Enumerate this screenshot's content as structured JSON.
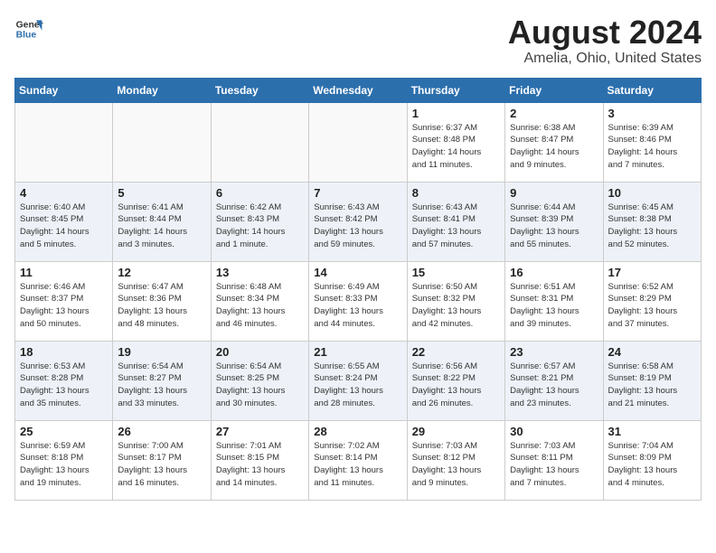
{
  "header": {
    "logo_line1": "General",
    "logo_line2": "Blue",
    "month_year": "August 2024",
    "location": "Amelia, Ohio, United States"
  },
  "weekdays": [
    "Sunday",
    "Monday",
    "Tuesday",
    "Wednesday",
    "Thursday",
    "Friday",
    "Saturday"
  ],
  "weeks": [
    [
      {
        "day": "",
        "info": ""
      },
      {
        "day": "",
        "info": ""
      },
      {
        "day": "",
        "info": ""
      },
      {
        "day": "",
        "info": ""
      },
      {
        "day": "1",
        "info": "Sunrise: 6:37 AM\nSunset: 8:48 PM\nDaylight: 14 hours\nand 11 minutes."
      },
      {
        "day": "2",
        "info": "Sunrise: 6:38 AM\nSunset: 8:47 PM\nDaylight: 14 hours\nand 9 minutes."
      },
      {
        "day": "3",
        "info": "Sunrise: 6:39 AM\nSunset: 8:46 PM\nDaylight: 14 hours\nand 7 minutes."
      }
    ],
    [
      {
        "day": "4",
        "info": "Sunrise: 6:40 AM\nSunset: 8:45 PM\nDaylight: 14 hours\nand 5 minutes."
      },
      {
        "day": "5",
        "info": "Sunrise: 6:41 AM\nSunset: 8:44 PM\nDaylight: 14 hours\nand 3 minutes."
      },
      {
        "day": "6",
        "info": "Sunrise: 6:42 AM\nSunset: 8:43 PM\nDaylight: 14 hours\nand 1 minute."
      },
      {
        "day": "7",
        "info": "Sunrise: 6:43 AM\nSunset: 8:42 PM\nDaylight: 13 hours\nand 59 minutes."
      },
      {
        "day": "8",
        "info": "Sunrise: 6:43 AM\nSunset: 8:41 PM\nDaylight: 13 hours\nand 57 minutes."
      },
      {
        "day": "9",
        "info": "Sunrise: 6:44 AM\nSunset: 8:39 PM\nDaylight: 13 hours\nand 55 minutes."
      },
      {
        "day": "10",
        "info": "Sunrise: 6:45 AM\nSunset: 8:38 PM\nDaylight: 13 hours\nand 52 minutes."
      }
    ],
    [
      {
        "day": "11",
        "info": "Sunrise: 6:46 AM\nSunset: 8:37 PM\nDaylight: 13 hours\nand 50 minutes."
      },
      {
        "day": "12",
        "info": "Sunrise: 6:47 AM\nSunset: 8:36 PM\nDaylight: 13 hours\nand 48 minutes."
      },
      {
        "day": "13",
        "info": "Sunrise: 6:48 AM\nSunset: 8:34 PM\nDaylight: 13 hours\nand 46 minutes."
      },
      {
        "day": "14",
        "info": "Sunrise: 6:49 AM\nSunset: 8:33 PM\nDaylight: 13 hours\nand 44 minutes."
      },
      {
        "day": "15",
        "info": "Sunrise: 6:50 AM\nSunset: 8:32 PM\nDaylight: 13 hours\nand 42 minutes."
      },
      {
        "day": "16",
        "info": "Sunrise: 6:51 AM\nSunset: 8:31 PM\nDaylight: 13 hours\nand 39 minutes."
      },
      {
        "day": "17",
        "info": "Sunrise: 6:52 AM\nSunset: 8:29 PM\nDaylight: 13 hours\nand 37 minutes."
      }
    ],
    [
      {
        "day": "18",
        "info": "Sunrise: 6:53 AM\nSunset: 8:28 PM\nDaylight: 13 hours\nand 35 minutes."
      },
      {
        "day": "19",
        "info": "Sunrise: 6:54 AM\nSunset: 8:27 PM\nDaylight: 13 hours\nand 33 minutes."
      },
      {
        "day": "20",
        "info": "Sunrise: 6:54 AM\nSunset: 8:25 PM\nDaylight: 13 hours\nand 30 minutes."
      },
      {
        "day": "21",
        "info": "Sunrise: 6:55 AM\nSunset: 8:24 PM\nDaylight: 13 hours\nand 28 minutes."
      },
      {
        "day": "22",
        "info": "Sunrise: 6:56 AM\nSunset: 8:22 PM\nDaylight: 13 hours\nand 26 minutes."
      },
      {
        "day": "23",
        "info": "Sunrise: 6:57 AM\nSunset: 8:21 PM\nDaylight: 13 hours\nand 23 minutes."
      },
      {
        "day": "24",
        "info": "Sunrise: 6:58 AM\nSunset: 8:19 PM\nDaylight: 13 hours\nand 21 minutes."
      }
    ],
    [
      {
        "day": "25",
        "info": "Sunrise: 6:59 AM\nSunset: 8:18 PM\nDaylight: 13 hours\nand 19 minutes."
      },
      {
        "day": "26",
        "info": "Sunrise: 7:00 AM\nSunset: 8:17 PM\nDaylight: 13 hours\nand 16 minutes."
      },
      {
        "day": "27",
        "info": "Sunrise: 7:01 AM\nSunset: 8:15 PM\nDaylight: 13 hours\nand 14 minutes."
      },
      {
        "day": "28",
        "info": "Sunrise: 7:02 AM\nSunset: 8:14 PM\nDaylight: 13 hours\nand 11 minutes."
      },
      {
        "day": "29",
        "info": "Sunrise: 7:03 AM\nSunset: 8:12 PM\nDaylight: 13 hours\nand 9 minutes."
      },
      {
        "day": "30",
        "info": "Sunrise: 7:03 AM\nSunset: 8:11 PM\nDaylight: 13 hours\nand 7 minutes."
      },
      {
        "day": "31",
        "info": "Sunrise: 7:04 AM\nSunset: 8:09 PM\nDaylight: 13 hours\nand 4 minutes."
      }
    ]
  ]
}
